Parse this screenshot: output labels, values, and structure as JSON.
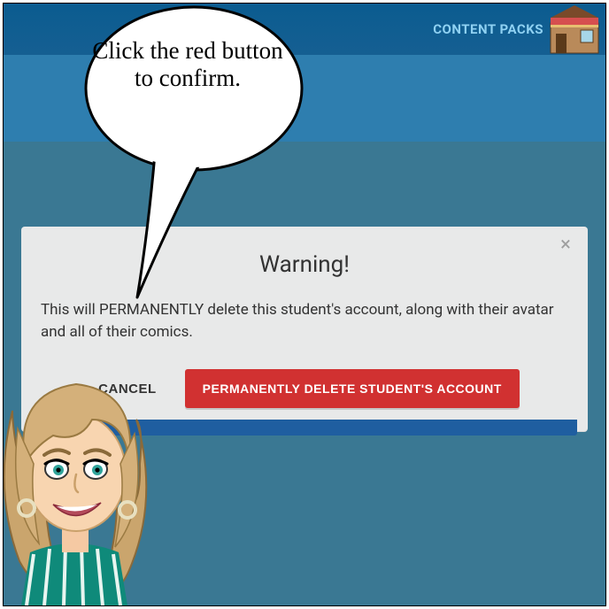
{
  "topbar": {
    "content_packs": "CONTENT PACKS"
  },
  "bubble": {
    "text": "Click the red button to confirm."
  },
  "dialog": {
    "title": "Warning!",
    "body": "This will PERMANENTLY delete this student's account, along with their avatar and all of their comics.",
    "cancel": "CANCEL",
    "delete": "PERMANENTLY DELETE STUDENT'S ACCOUNT"
  }
}
